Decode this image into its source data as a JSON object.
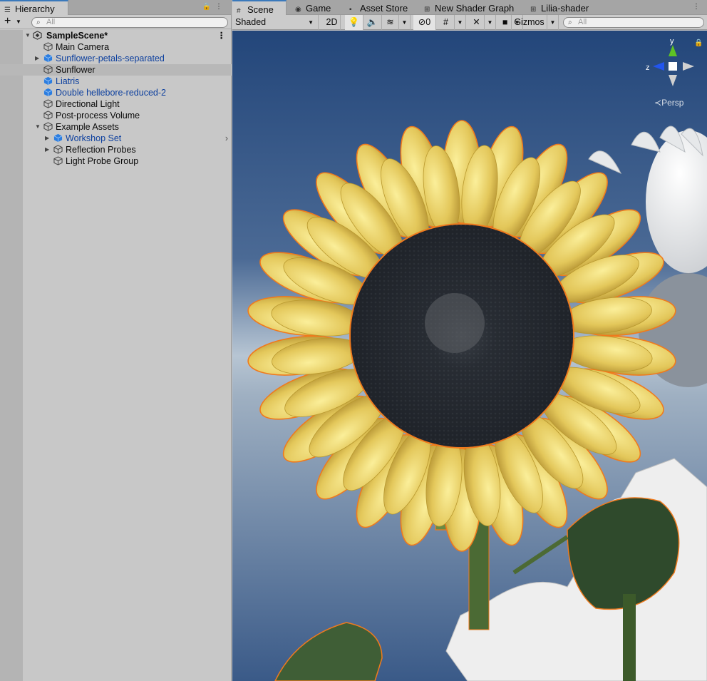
{
  "hierarchy": {
    "tab_label": "Hierarchy",
    "search_placeholder": "All",
    "items": [
      {
        "label": "SampleScene*"
      },
      {
        "label": "Main Camera"
      },
      {
        "label": "Sunflower-petals-separated"
      },
      {
        "label": "Sunflower"
      },
      {
        "label": "Liatris"
      },
      {
        "label": "Double hellebore-reduced-2"
      },
      {
        "label": "Directional Light"
      },
      {
        "label": "Post-process Volume"
      },
      {
        "label": "Example Assets"
      },
      {
        "label": "Workshop Set"
      },
      {
        "label": "Reflection Probes"
      },
      {
        "label": "Light Probe Group"
      }
    ]
  },
  "scene": {
    "tabs": [
      {
        "label": "Scene"
      },
      {
        "label": "Game"
      },
      {
        "label": "Asset Store"
      },
      {
        "label": "New Shader Graph"
      },
      {
        "label": "Lilia-shader"
      }
    ],
    "toolbar": {
      "draw_mode": "Shaded",
      "mode_2d": "2D",
      "hidden_count": "0",
      "gizmos": "Gizmos",
      "search_placeholder": "All"
    },
    "gizmo": {
      "y_axis": "y",
      "z_axis": "z",
      "projection": "Persp"
    }
  },
  "colors": {
    "selection_outline": "#f07a1d",
    "prefab_text": "#0c3f9e",
    "active_tab_accent": "#3a79bb",
    "petal_yellow": "#e3c75a",
    "disk_dark": "#25292f",
    "sky_top": "#27487a",
    "sky_horizon": "#b6c4d2"
  }
}
